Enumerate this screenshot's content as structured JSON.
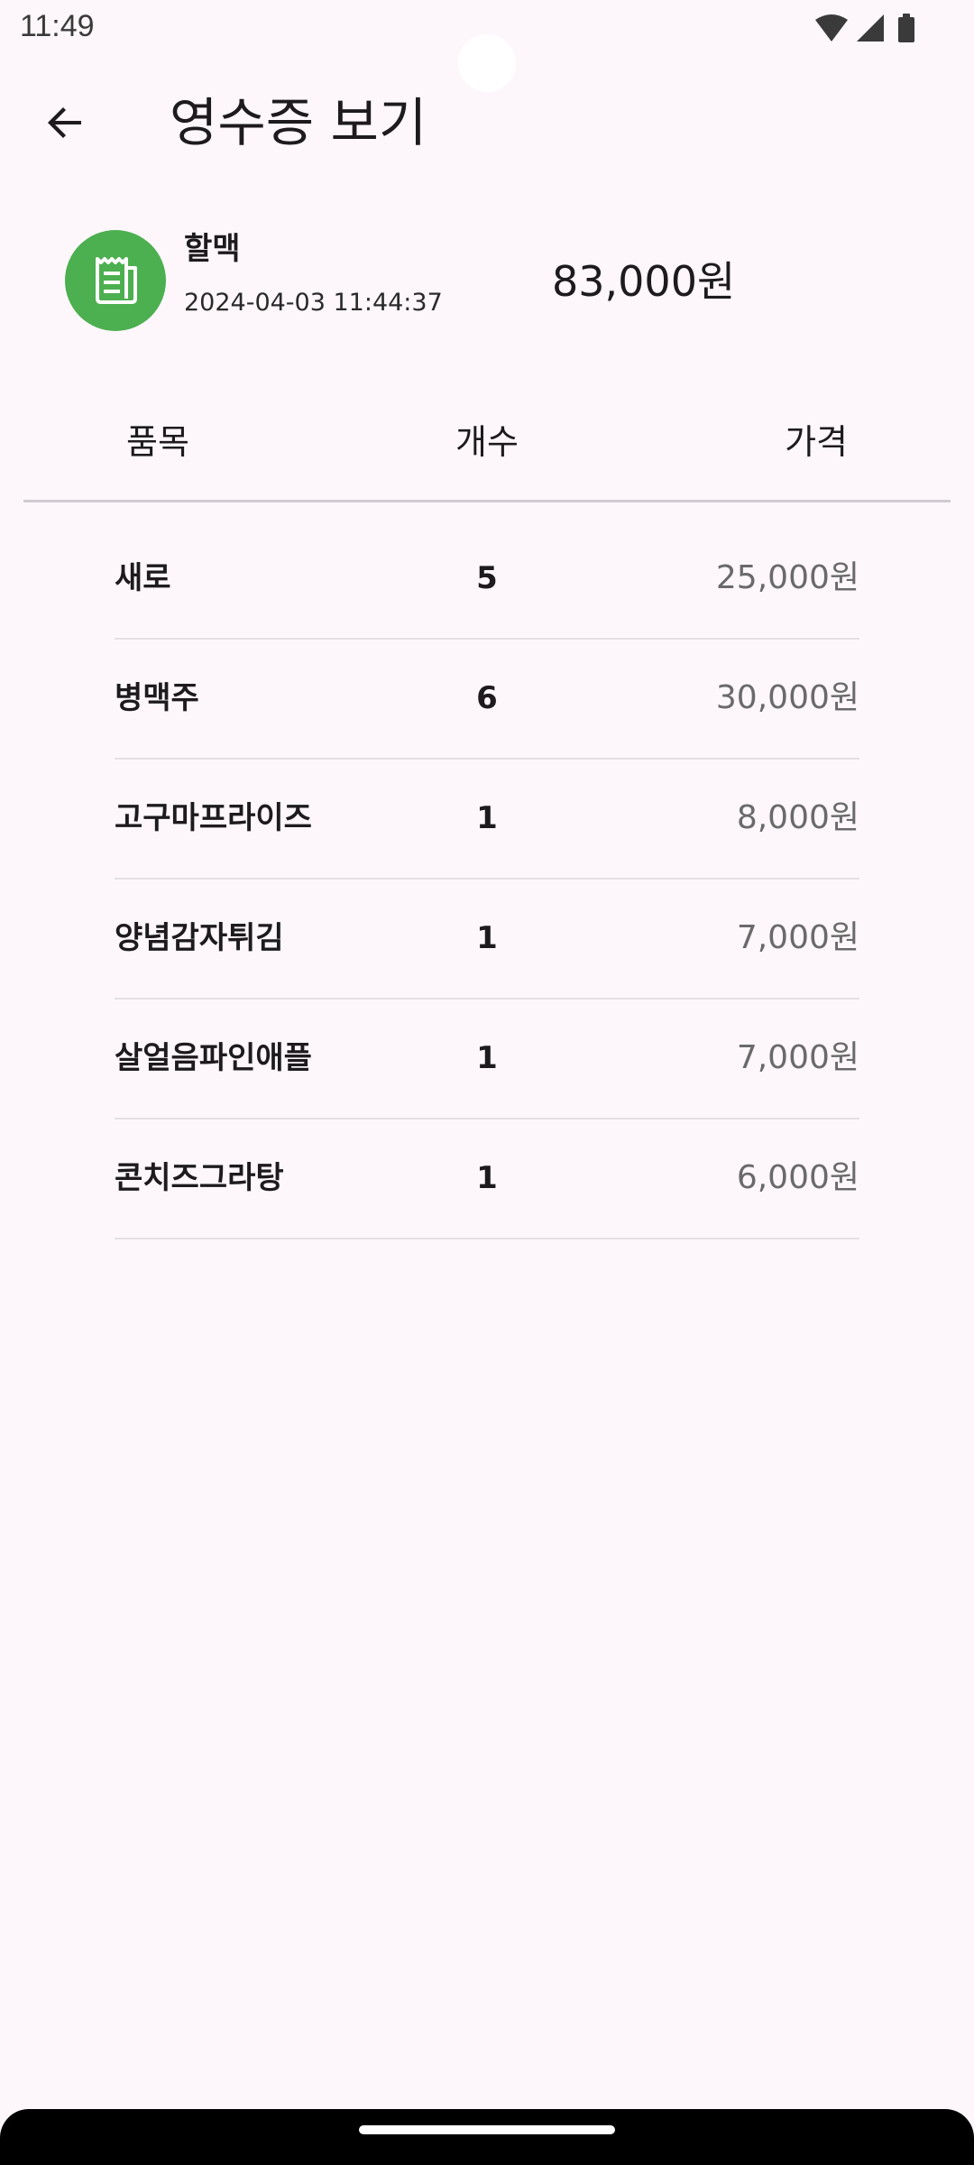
{
  "status_bar": {
    "time": "11:49",
    "icons": [
      "wifi-icon",
      "signal-icon",
      "battery-icon"
    ]
  },
  "app_bar": {
    "back_icon": "arrow-back-icon",
    "title": "영수증 보기"
  },
  "summary": {
    "store_icon": "receipt-icon",
    "store_icon_color": "#4caf50",
    "store_name": "할맥",
    "datetime": "2024-04-03 11:44:37",
    "total": "83,000원"
  },
  "table": {
    "headers": {
      "item": "품목",
      "quantity": "개수",
      "price": "가격"
    },
    "rows": [
      {
        "name": "새로",
        "quantity": "5",
        "price": "25,000원"
      },
      {
        "name": "병맥주",
        "quantity": "6",
        "price": "30,000원"
      },
      {
        "name": "고구마프라이즈",
        "quantity": "1",
        "price": "8,000원"
      },
      {
        "name": "양념감자튀김",
        "quantity": "1",
        "price": "7,000원"
      },
      {
        "name": "살얼음파인애플",
        "quantity": "1",
        "price": "7,000원"
      },
      {
        "name": "콘치즈그라탕",
        "quantity": "1",
        "price": "6,000원"
      }
    ]
  }
}
